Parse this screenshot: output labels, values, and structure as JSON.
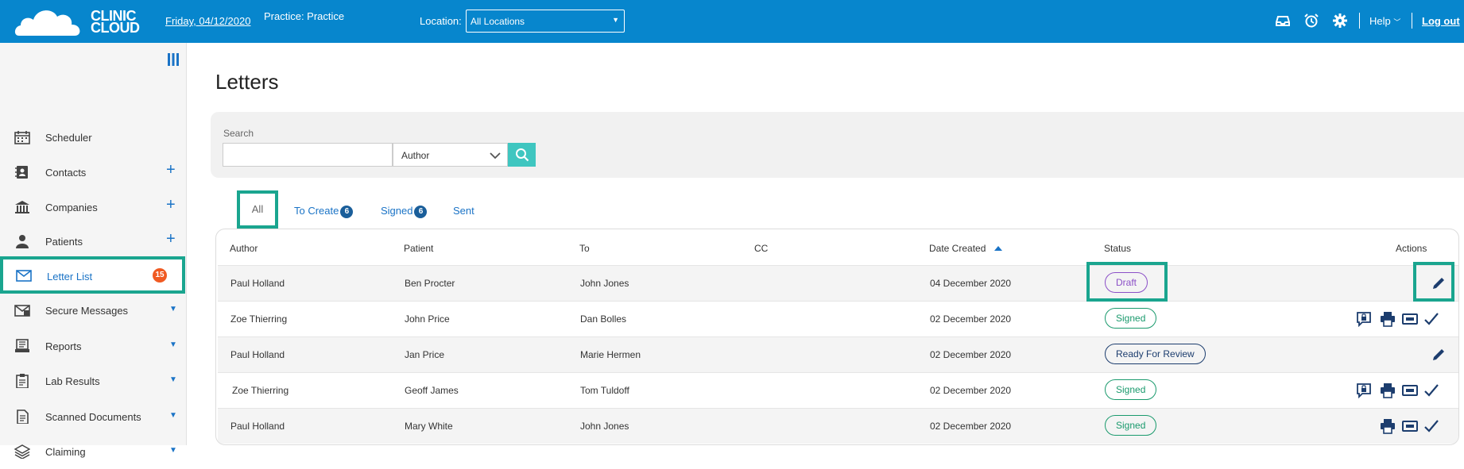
{
  "header": {
    "logo_line1": "CLINIC",
    "logo_line2": "CLOUD",
    "date": "Friday, 04/12/2020",
    "practice": "Practice: Practice",
    "location_label": "Location:",
    "location_value": "All Locations",
    "help": "Help",
    "logout": "Log out"
  },
  "sidebar": {
    "items": [
      {
        "label": "Scheduler",
        "icon": "calendar-icon"
      },
      {
        "label": "Contacts",
        "icon": "contacts-icon"
      },
      {
        "label": "Companies",
        "icon": "building-icon"
      },
      {
        "label": "Patients",
        "icon": "person-icon"
      },
      {
        "label": "Letter List",
        "icon": "envelope-icon",
        "badge": "15"
      },
      {
        "label": "Secure Messages",
        "icon": "secure-mail-icon"
      },
      {
        "label": "Reports",
        "icon": "reports-icon"
      },
      {
        "label": "Lab Results",
        "icon": "clipboard-icon"
      },
      {
        "label": "Scanned Documents",
        "icon": "document-icon"
      },
      {
        "label": "Claiming",
        "icon": "layers-icon"
      }
    ]
  },
  "main": {
    "title": "Letters",
    "search_label": "Search",
    "search_value": "",
    "filter_value": "Author",
    "tabs": [
      {
        "label": "All"
      },
      {
        "label": "To Create",
        "count": "6"
      },
      {
        "label": "Signed",
        "count": "6"
      },
      {
        "label": "Sent"
      }
    ],
    "columns": [
      "Author",
      "Patient",
      "To",
      "CC",
      "Date Created",
      "Status",
      "Actions"
    ],
    "rows": [
      {
        "author": "Paul Holland",
        "patient": "Ben Procter",
        "to": "John Jones",
        "cc": "",
        "date": "04 December 2020",
        "status": "Draft"
      },
      {
        "author": "Zoe Thierring",
        "patient": "John Price",
        "to": "Dan Bolles",
        "cc": "",
        "date": "02 December 2020",
        "status": "Signed"
      },
      {
        "author": "Paul Holland",
        "patient": "Jan Price",
        "to": "Marie Hermen",
        "cc": "",
        "date": "02 December 2020",
        "status": "Ready For Review"
      },
      {
        "author": "Zoe Thierring",
        "patient": "Geoff James",
        "to": "Tom Tuldoff",
        "cc": "",
        "date": "02 December 2020",
        "status": "Signed"
      },
      {
        "author": "Paul Holland",
        "patient": "Mary White",
        "to": "John Jones",
        "cc": "",
        "date": "02 December 2020",
        "status": "Signed"
      }
    ]
  },
  "colors": {
    "topbar": "#0786cd",
    "highlight": "#1aa58f",
    "link": "#1a73c6",
    "badge": "#f05a22"
  }
}
